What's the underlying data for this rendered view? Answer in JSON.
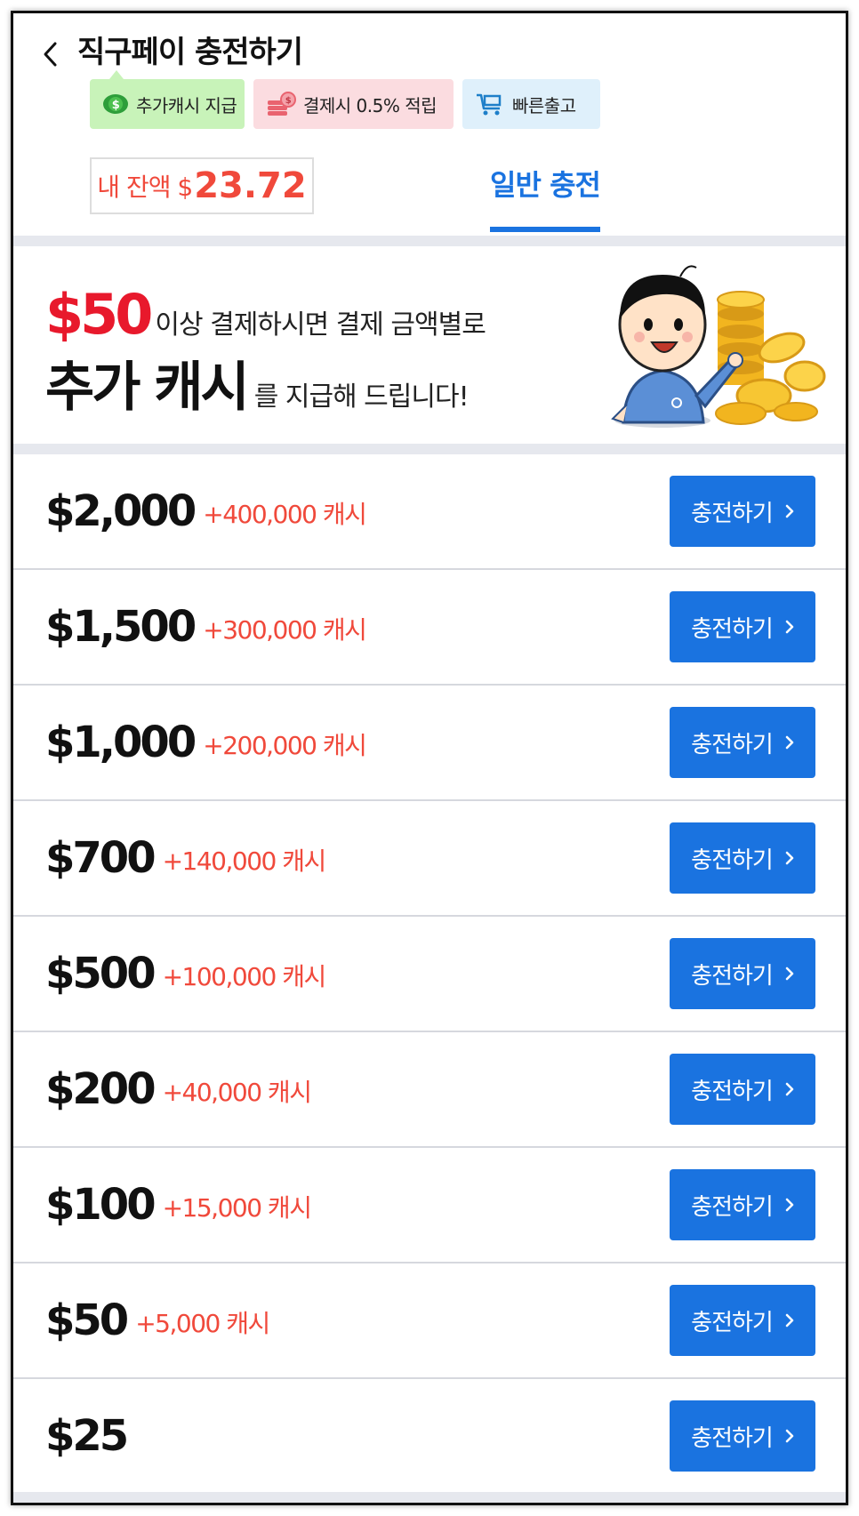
{
  "header": {
    "title": "직구페이 충전하기"
  },
  "badges": [
    {
      "label": "추가캐시 지급",
      "icon": "dollar-coin-icon",
      "color": "#c8f3b9"
    },
    {
      "label": "결제시 0.5% 적립",
      "icon": "coin-stack-icon",
      "color": "#fbdce0"
    },
    {
      "label": "빠른출고",
      "icon": "cart-icon",
      "color": "#dff0fb"
    }
  ],
  "balance": {
    "label": "내 잔액 $",
    "amount": "23.72"
  },
  "tabs": [
    {
      "label": "일반 충전",
      "active": true
    }
  ],
  "promo": {
    "amount": "$50",
    "line1": "이상 결제하시면 결제 금액별로",
    "highlight": "추가 캐시",
    "line2": "를 지급해 드립니다!"
  },
  "charge_options": [
    {
      "amount": "$2,000",
      "bonus": "+400,000 캐시",
      "button": "충전하기"
    },
    {
      "amount": "$1,500",
      "bonus": "+300,000 캐시",
      "button": "충전하기"
    },
    {
      "amount": "$1,000",
      "bonus": "+200,000 캐시",
      "button": "충전하기"
    },
    {
      "amount": "$700",
      "bonus": "+140,000 캐시",
      "button": "충전하기"
    },
    {
      "amount": "$500",
      "bonus": "+100,000 캐시",
      "button": "충전하기"
    },
    {
      "amount": "$200",
      "bonus": "+40,000 캐시",
      "button": "충전하기"
    },
    {
      "amount": "$100",
      "bonus": "+15,000 캐시",
      "button": "충전하기"
    },
    {
      "amount": "$50",
      "bonus": "+5,000 캐시",
      "button": "충전하기"
    },
    {
      "amount": "$25",
      "bonus": "",
      "button": "충전하기"
    }
  ],
  "colors": {
    "accent": "#1a73e0",
    "bonus_red": "#f0493b",
    "promo_red": "#e8192c"
  }
}
